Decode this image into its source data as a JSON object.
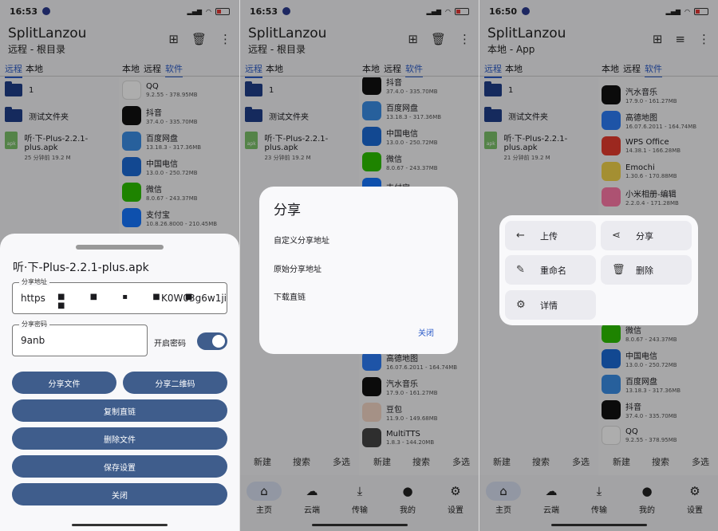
{
  "panels": [
    {
      "time": "16:53",
      "app_title": "SplitLanzou",
      "subtitle": "远程 - 根目录",
      "left_tabs": [
        "远程",
        "本地"
      ],
      "right_tabs": [
        "本地",
        "远程",
        "软件"
      ],
      "left_items": {
        "folders": [
          "1",
          "测试文件夹"
        ],
        "apk": {
          "name": "听·下-Plus-2.2.1-plus.apk",
          "meta": "25 分钟前 19.2 M",
          "tag": "apk"
        }
      },
      "apps": [
        {
          "name": "QQ",
          "meta": "9.2.55 - 378.95MB",
          "icon": "qq-icon",
          "color": "#ffffff"
        },
        {
          "name": "抖音",
          "meta": "37.4.0 - 335.70MB",
          "icon": "douyin-icon",
          "color": "#111111"
        },
        {
          "name": "百度网盘",
          "meta": "13.18.3 - 317.36MB",
          "icon": "baidu-pan-icon",
          "color": "#3a8ee6"
        },
        {
          "name": "中国电信",
          "meta": "13.0.0 - 250.72MB",
          "icon": "china-telecom-icon",
          "color": "#1b6bd6"
        },
        {
          "name": "微信",
          "meta": "8.0.67 - 243.37MB",
          "icon": "wechat-icon",
          "color": "#2dc100"
        },
        {
          "name": "支付宝",
          "meta": "10.8.26.8000 - 210.45MB",
          "icon": "alipay-icon",
          "color": "#1677ff"
        }
      ],
      "sheet": {
        "filename": "听·下-Plus-2.2.1-plus.apk",
        "share_addr_label": "分享地址",
        "share_addr_prefix": "https",
        "share_addr_suffix": "K0W03g6w1ji",
        "password_label": "分享密码",
        "password_value": "9anb",
        "enable_password_label": "开启密码",
        "buttons": {
          "share_file": "分享文件",
          "share_qr": "分享二维码",
          "copy_link": "复制直链",
          "delete_file": "删除文件",
          "save_settings": "保存设置",
          "close": "关闭"
        }
      }
    },
    {
      "time": "16:53",
      "app_title": "SplitLanzou",
      "subtitle": "远程 - 根目录",
      "left_tabs": [
        "远程",
        "本地"
      ],
      "right_tabs": [
        "本地",
        "远程",
        "软件"
      ],
      "left_items": {
        "folders": [
          "1",
          "测试文件夹"
        ],
        "apk": {
          "name": "听·下-Plus-2.2.1-plus.apk",
          "meta": "23 分钟前 19.2 M",
          "tag": "apk"
        }
      },
      "apps": [
        {
          "name": "抖音",
          "meta": "37.4.0 - 335.70MB",
          "icon": "douyin-icon",
          "color": "#111111"
        },
        {
          "name": "百度网盘",
          "meta": "13.18.3 - 317.36MB",
          "icon": "baidu-pan-icon",
          "color": "#3a8ee6"
        },
        {
          "name": "中国电信",
          "meta": "13.0.0 - 250.72MB",
          "icon": "china-telecom-icon",
          "color": "#1b6bd6"
        },
        {
          "name": "微信",
          "meta": "8.0.67 - 243.37MB",
          "icon": "wechat-icon",
          "color": "#2dc100"
        },
        {
          "name": "支付宝",
          "meta": "",
          "icon": "alipay-icon",
          "color": "#1677ff"
        }
      ],
      "apps_lower": [
        {
          "name": "高德地图",
          "meta": "16.07.6.2011 - 164.74MB",
          "icon": "amap-icon",
          "color": "#2d7cf6"
        },
        {
          "name": "汽水音乐",
          "meta": "17.9.0 - 161.27MB",
          "icon": "qishui-music-icon",
          "color": "#111111"
        },
        {
          "name": "豆包",
          "meta": "11.9.0 - 149.68MB",
          "icon": "doubao-icon",
          "color": "#f3d6c6"
        },
        {
          "name": "MultiTTS",
          "meta": "1.8.3 - 144.20MB",
          "icon": "multitts-icon",
          "color": "#444444"
        }
      ],
      "dialog": {
        "title": "分享",
        "items": [
          "自定义分享地址",
          "原始分享地址",
          "下载直链"
        ],
        "close": "关闭"
      }
    },
    {
      "time": "16:50",
      "app_title": "SplitLanzou",
      "subtitle": "本地 - App",
      "left_tabs": [
        "远程",
        "本地"
      ],
      "right_tabs": [
        "本地",
        "远程",
        "软件"
      ],
      "left_items": {
        "folders": [
          "1",
          "测试文件夹"
        ],
        "apk": {
          "name": "听·下-Plus-2.2.1-plus.apk",
          "meta": "21 分钟前 19.2 M",
          "tag": "apk"
        }
      },
      "apps": [
        {
          "name": "汽水音乐",
          "meta": "17.9.0 - 161.27MB",
          "icon": "qishui-music-icon",
          "color": "#111111"
        },
        {
          "name": "高德地图",
          "meta": "16.07.6.2011 - 164.74MB",
          "icon": "amap-icon",
          "color": "#2d7cf6"
        },
        {
          "name": "WPS Office",
          "meta": "14.38.1 - 166.28MB",
          "icon": "wps-icon",
          "color": "#e63b2e"
        },
        {
          "name": "Emochi",
          "meta": "1.30.6 - 170.88MB",
          "icon": "emochi-icon",
          "color": "#f2d34a"
        },
        {
          "name": "小米相册-编辑",
          "meta": "2.2.0.4 - 171.28MB",
          "icon": "mi-gallery-icon",
          "color": "#ff7aa8"
        }
      ],
      "apps_lower": [
        {
          "name": "微信",
          "meta": "8.0.67 - 243.37MB",
          "icon": "wechat-icon",
          "color": "#2dc100"
        },
        {
          "name": "中国电信",
          "meta": "13.0.0 - 250.72MB",
          "icon": "china-telecom-icon",
          "color": "#1b6bd6"
        },
        {
          "name": "百度网盘",
          "meta": "13.18.3 - 317.36MB",
          "icon": "baidu-pan-icon",
          "color": "#3a8ee6"
        },
        {
          "name": "抖音",
          "meta": "37.4.0 - 335.70MB",
          "icon": "douyin-icon",
          "color": "#111111"
        },
        {
          "name": "QQ",
          "meta": "9.2.55 - 378.95MB",
          "icon": "qq-icon",
          "color": "#ffffff"
        }
      ],
      "menu": {
        "upload": "上传",
        "share": "分享",
        "rename": "重命名",
        "delete": "删除",
        "details": "详情"
      }
    }
  ],
  "bottom_actions": [
    "新建",
    "搜索",
    "多选",
    "新建",
    "搜索",
    "多选"
  ],
  "nav": [
    "主页",
    "云端",
    "传输",
    "我的",
    "设置"
  ],
  "accent": "#3f5d8c"
}
